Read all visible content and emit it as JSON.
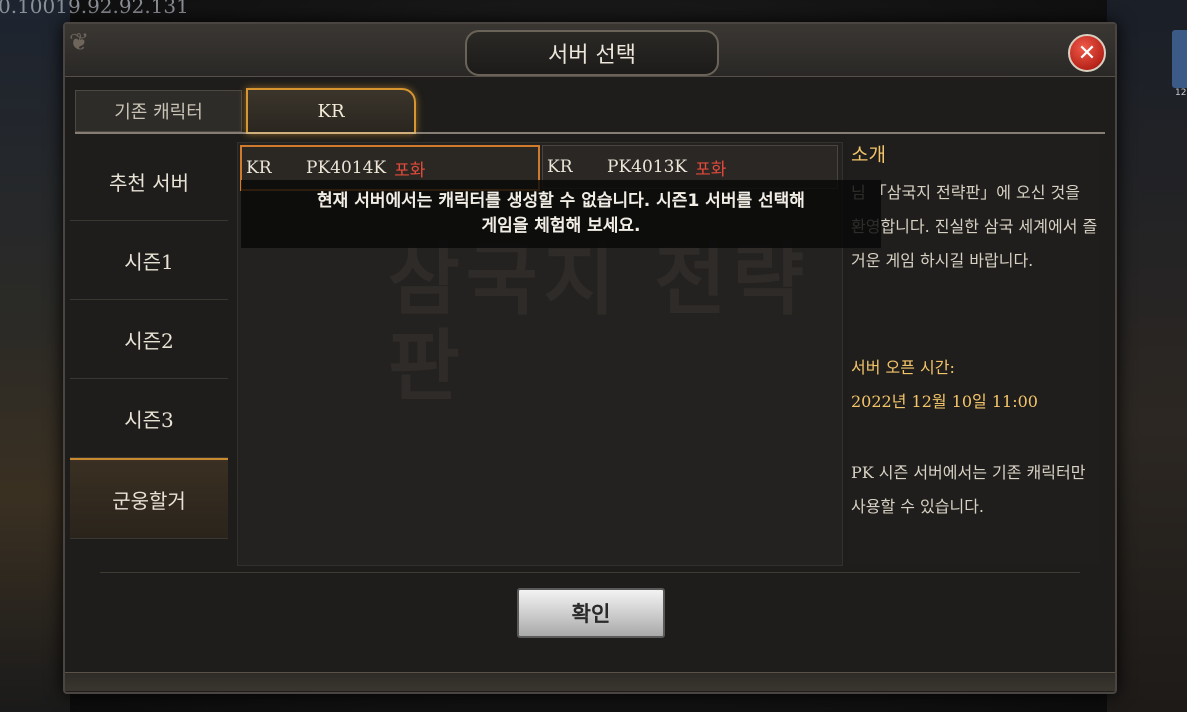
{
  "status_overlay": {
    "ip": "0.10019.92.92.131"
  },
  "dialog": {
    "title": "서버 선택",
    "tabs": [
      {
        "label": "기존 캐릭터"
      },
      {
        "label": "KR"
      }
    ],
    "sidebar": [
      {
        "label": "추천 서버"
      },
      {
        "label": "시즌1"
      },
      {
        "label": "시즌2"
      },
      {
        "label": "시즌3"
      },
      {
        "label": "군웅할거"
      }
    ],
    "servers": [
      {
        "region": "KR",
        "name": "PK4014K",
        "status": "포화"
      },
      {
        "region": "KR",
        "name": "PK4013K",
        "status": "포화"
      }
    ],
    "toast_line1": "현재 서버에서는 캐릭터를 생성할 수 없습니다. 시즌1 서버를 선택해",
    "toast_line2": "게임을 체험해 보세요.",
    "watermark": "삼국지 전략판",
    "intro": {
      "title": "소개",
      "body": "님 「삼국지 전략판」에 오신 것을 환영합니다. 진실한 삼국 세계에서 즐거운 게임 하시길 바랍니다.",
      "open_label": "서버 오픈 시간:",
      "open_date": "2022년 12월 10일 11:00",
      "note": "PK 시즌 서버에서는 기존 캐릭터만 사용할 수 있습니다."
    },
    "confirm_label": "확인"
  },
  "side_badge": "12",
  "colors": {
    "accent_orange": "#d7962f",
    "full_status_red": "#e24a3a",
    "intro_gold": "#f3c56a"
  }
}
